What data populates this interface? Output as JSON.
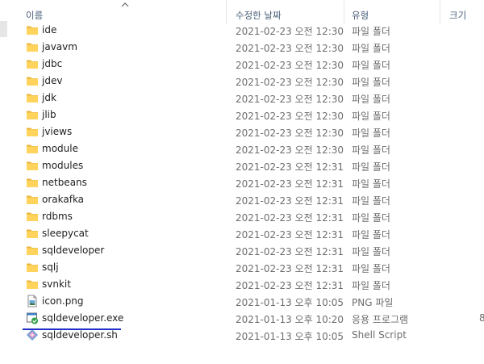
{
  "columns": {
    "name": "이름",
    "modified": "수정한 날짜",
    "type": "유형",
    "size": "크기"
  },
  "rows": [
    {
      "name": "ide",
      "date": "2021-02-23 오전 12:30",
      "type": "파일 폴더",
      "size": "",
      "icon": "folder-icon"
    },
    {
      "name": "javavm",
      "date": "2021-02-23 오전 12:30",
      "type": "파일 폴더",
      "size": "",
      "icon": "folder-icon"
    },
    {
      "name": "jdbc",
      "date": "2021-02-23 오전 12:30",
      "type": "파일 폴더",
      "size": "",
      "icon": "folder-icon"
    },
    {
      "name": "jdev",
      "date": "2021-02-23 오전 12:30",
      "type": "파일 폴더",
      "size": "",
      "icon": "folder-icon"
    },
    {
      "name": "jdk",
      "date": "2021-02-23 오전 12:30",
      "type": "파일 폴더",
      "size": "",
      "icon": "folder-icon"
    },
    {
      "name": "jlib",
      "date": "2021-02-23 오전 12:30",
      "type": "파일 폴더",
      "size": "",
      "icon": "folder-icon"
    },
    {
      "name": "jviews",
      "date": "2021-02-23 오전 12:30",
      "type": "파일 폴더",
      "size": "",
      "icon": "folder-icon"
    },
    {
      "name": "module",
      "date": "2021-02-23 오전 12:30",
      "type": "파일 폴더",
      "size": "",
      "icon": "folder-icon"
    },
    {
      "name": "modules",
      "date": "2021-02-23 오전 12:31",
      "type": "파일 폴더",
      "size": "",
      "icon": "folder-icon"
    },
    {
      "name": "netbeans",
      "date": "2021-02-23 오전 12:31",
      "type": "파일 폴더",
      "size": "",
      "icon": "folder-icon"
    },
    {
      "name": "orakafka",
      "date": "2021-02-23 오전 12:31",
      "type": "파일 폴더",
      "size": "",
      "icon": "folder-icon"
    },
    {
      "name": "rdbms",
      "date": "2021-02-23 오전 12:31",
      "type": "파일 폴더",
      "size": "",
      "icon": "folder-icon"
    },
    {
      "name": "sleepycat",
      "date": "2021-02-23 오전 12:31",
      "type": "파일 폴더",
      "size": "",
      "icon": "folder-icon"
    },
    {
      "name": "sqldeveloper",
      "date": "2021-02-23 오전 12:31",
      "type": "파일 폴더",
      "size": "",
      "icon": "folder-icon"
    },
    {
      "name": "sqlj",
      "date": "2021-02-23 오전 12:31",
      "type": "파일 폴더",
      "size": "",
      "icon": "folder-icon"
    },
    {
      "name": "svnkit",
      "date": "2021-02-23 오전 12:31",
      "type": "파일 폴더",
      "size": "",
      "icon": "folder-icon"
    },
    {
      "name": "icon.png",
      "date": "2021-01-13 오후 10:05",
      "type": "PNG 파일",
      "size": "",
      "icon": "png-file-icon"
    },
    {
      "name": "sqldeveloper.exe",
      "date": "2021-01-13 오후 10:20",
      "type": "응용 프로그램",
      "size": "8",
      "icon": "exe-file-icon"
    },
    {
      "name": "sqldeveloper.sh",
      "date": "2021-01-13 오후 10:05",
      "type": "Shell Script",
      "size": "",
      "icon": "shell-script-icon"
    }
  ],
  "colors": {
    "folder": "#ffd35c",
    "annotation_underline": "#1f2fc7",
    "header_text": "#4c607a",
    "secondary_text": "#6d6d6d"
  }
}
